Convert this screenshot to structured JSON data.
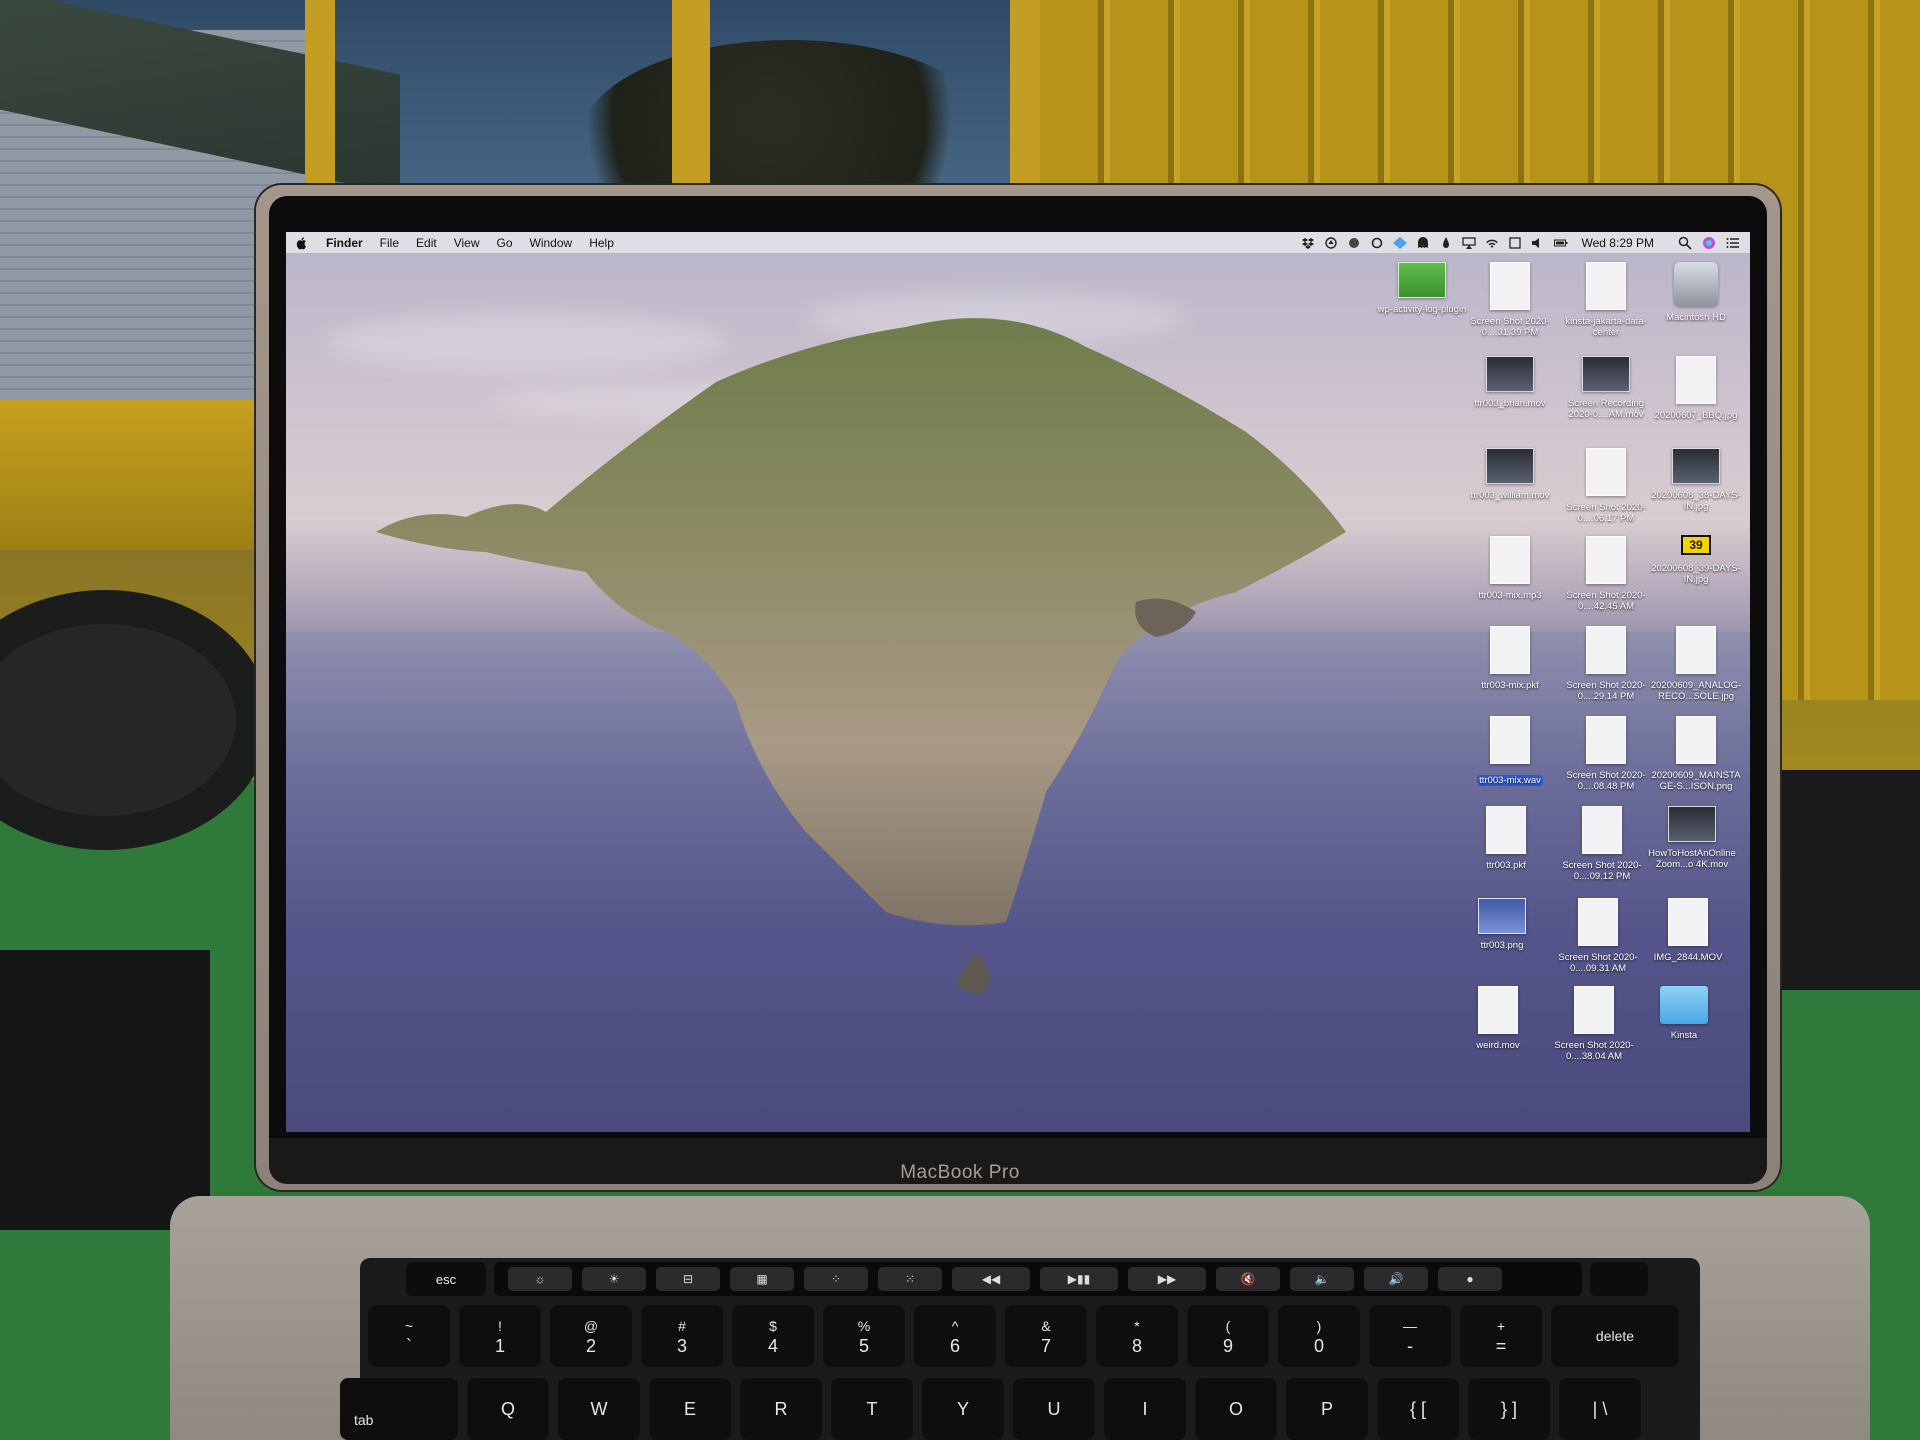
{
  "menubar": {
    "app": "Finder",
    "items": [
      "File",
      "Edit",
      "View",
      "Go",
      "Window",
      "Help"
    ],
    "clock": "Wed 8:29 PM"
  },
  "desktop_icons": [
    {
      "label": "wp-activity-log-plugin",
      "kind": "green"
    },
    {
      "label": "Screen Shot 2020-0....31.39 PM",
      "kind": "doc"
    },
    {
      "label": "kinsta-jakarta-data-center",
      "kind": "doc"
    },
    {
      "label": "Macintosh HD",
      "kind": "drive"
    },
    {
      "label": "ttr003_brian.mov",
      "kind": "video"
    },
    {
      "label": "Screen Recording 2020-0....AM.mov",
      "kind": "video"
    },
    {
      "label": "20200607_BBQ.jpg",
      "kind": "doc"
    },
    {
      "label": "ttr003_william.mov",
      "kind": "video"
    },
    {
      "label": "Screen Shot 2020-0....06.17 PM",
      "kind": "doc"
    },
    {
      "label": "20200608_38-DAYS-IN.jpg",
      "kind": "video"
    },
    {
      "label": "ttr003-mix.mp3",
      "kind": "doc"
    },
    {
      "label": "Screen Shot 2020-0....42.45 AM",
      "kind": "doc"
    },
    {
      "label": "20200608_39-DAYS-IN.jpg",
      "kind": "yellow",
      "badge": "39"
    },
    {
      "label": "ttr003-mix.pkf",
      "kind": "doc"
    },
    {
      "label": "Screen Shot 2020-0....29.14 PM",
      "kind": "doc"
    },
    {
      "label": "20200609_ANALOG-RECO...SOLE.jpg",
      "kind": "doc"
    },
    {
      "label": "ttr003-mix.wav",
      "kind": "doc",
      "selected": true
    },
    {
      "label": "Screen Shot 2020-0....08.48 PM",
      "kind": "doc"
    },
    {
      "label": "20200609_MAINSTAGE-S...ISON.png",
      "kind": "doc"
    },
    {
      "label": "ttr003.pkf",
      "kind": "doc"
    },
    {
      "label": "Screen Shot 2020-0....09.12 PM",
      "kind": "doc"
    },
    {
      "label": "HowToHostAnOnlineZoom...o 4K.mov",
      "kind": "video"
    },
    {
      "label": "ttr003.png",
      "kind": "blue"
    },
    {
      "label": "Screen Shot 2020-0....09.31 AM",
      "kind": "doc"
    },
    {
      "label": "IMG_2844.MOV",
      "kind": "doc"
    },
    {
      "label": "weird.mov",
      "kind": "doc"
    },
    {
      "label": "Screen Shot 2020-0....38.04 AM",
      "kind": "doc"
    },
    {
      "label": "Kinsta",
      "kind": "folder"
    }
  ],
  "laptop": {
    "brand": "MacBook Pro"
  },
  "keyboard": {
    "esc": "esc",
    "touchbar": [
      "☼",
      "☀",
      "⊟",
      "▦",
      "⁘",
      "⁙",
      "◀◀",
      "▶▮▮",
      "▶▶",
      "🔇",
      "🔈",
      "🔊",
      "●"
    ],
    "number_row": [
      {
        "top": "~",
        "bottom": "`"
      },
      {
        "top": "!",
        "bottom": "1"
      },
      {
        "top": "@",
        "bottom": "2"
      },
      {
        "top": "#",
        "bottom": "3"
      },
      {
        "top": "$",
        "bottom": "4"
      },
      {
        "top": "%",
        "bottom": "5"
      },
      {
        "top": "^",
        "bottom": "6"
      },
      {
        "top": "&",
        "bottom": "7"
      },
      {
        "top": "*",
        "bottom": "8"
      },
      {
        "top": "(",
        "bottom": "9"
      },
      {
        "top": ")",
        "bottom": "0"
      },
      {
        "top": "—",
        "bottom": "-"
      },
      {
        "top": "+",
        "bottom": "="
      },
      {
        "top": "",
        "bottom": "delete"
      }
    ],
    "q_row": [
      "tab",
      "Q",
      "W",
      "E",
      "R",
      "T",
      "Y",
      "U",
      "I",
      "O",
      "P",
      "{ [",
      "} ]",
      "| \\"
    ]
  }
}
